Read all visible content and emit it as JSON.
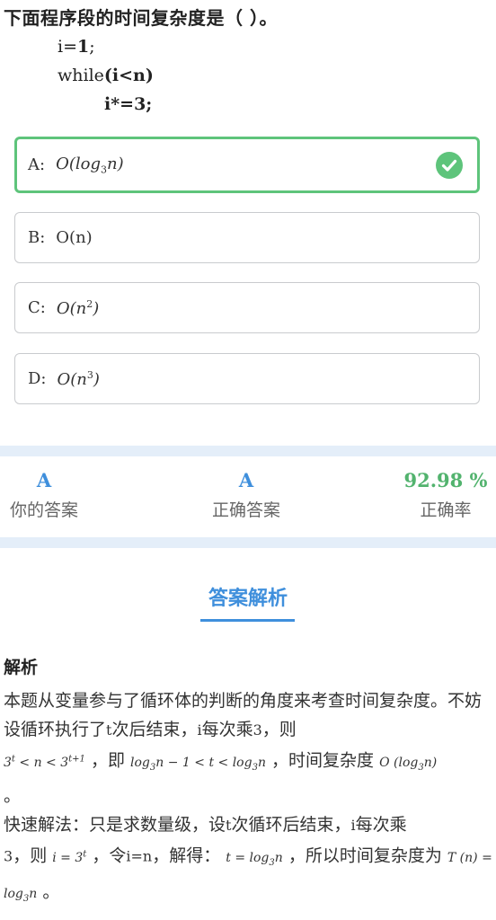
{
  "question": {
    "title": "下面程序段的时间复杂度是（ ）。",
    "code": {
      "line1_pre": "i=",
      "line1_bold": "1",
      "line1_post": ";",
      "line2_pre": "while",
      "line2_bold": "(i<n)",
      "line3_bold": "i*=3;"
    }
  },
  "options": [
    {
      "letter": "A:",
      "pre": "O(",
      "main": "log",
      "sub": "3",
      "post": "n)",
      "status": "correct"
    },
    {
      "letter": "B:",
      "text": "O(n)"
    },
    {
      "letter": "C:",
      "pre": "O(n",
      "sup": "2",
      "post": ")"
    },
    {
      "letter": "D:",
      "pre": "O(n",
      "sup": "3",
      "post": ")"
    }
  ],
  "result": {
    "your_answer": {
      "value": "A",
      "label": "你的答案"
    },
    "correct_answer": {
      "value": "A",
      "label": "正确答案"
    },
    "accuracy": {
      "value": "92.98 %",
      "label": "正确率"
    }
  },
  "analysis": {
    "tab_label": "答案解析",
    "heading": "解析",
    "p1_a": "本题从变量参与了循环体的判断的角度来考查时间复杂度。不妨设循环执行了",
    "p1_t": "t",
    "p1_b": "次后结束，",
    "p1_i": "i",
    "p1_c": "每次乘",
    "p1_3": "3",
    "p1_d": "，则",
    "f1": "3",
    "f1_sup": "t",
    "f1_mid": " < n < 3",
    "f1_sup2": "t+1",
    "p1_e": "，即",
    "f2": "log",
    "f2_sub": "3",
    "f2_post": "n − 1 < t < log",
    "f2_sub2": "3",
    "f2_post2": "n",
    "p1_f": "，时间复杂度",
    "f3": "O (log",
    "f3_sub": "3",
    "f3_post": "n)",
    "p1_end": "。",
    "p2_a": "快速解法：只是求数量级，设",
    "p2_t": "t",
    "p2_b": "次循环后结束，",
    "p2_i": "i",
    "p2_c": "每次乘",
    "p2_3": "3",
    "p2_d": "，则",
    "f4": "i = 3",
    "f4_sup": "t",
    "p2_e": "，令",
    "p2_in": "i=n",
    "p2_f": "，解得：",
    "f5": "t = log",
    "f5_sub": "3",
    "f5_post": "n",
    "p2_g": "，所以时间复杂度为",
    "f6": "T (n) = log",
    "f6_sub": "3",
    "f6_post": "n",
    "p2_end": "。"
  },
  "colors": {
    "accent": "#3f8fdc",
    "correct": "#5ec47b",
    "band": "#e4eef9"
  }
}
